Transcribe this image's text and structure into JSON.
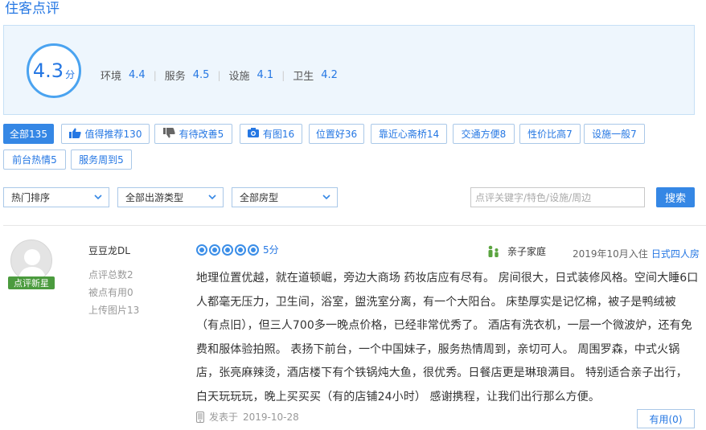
{
  "section_title": "住客点评",
  "overall": {
    "score": "4.3",
    "unit": "分"
  },
  "sub_scores": [
    {
      "label": "环境",
      "value": "4.4"
    },
    {
      "label": "服务",
      "value": "4.5"
    },
    {
      "label": "设施",
      "value": "4.1"
    },
    {
      "label": "卫生",
      "value": "4.2"
    }
  ],
  "tags": [
    {
      "label": "全部135",
      "active": true,
      "icon": ""
    },
    {
      "label": "值得推荐130",
      "active": false,
      "icon": "thumbs-up-icon"
    },
    {
      "label": "有待改善5",
      "active": false,
      "icon": "thumbs-down-icon"
    },
    {
      "label": "有图16",
      "active": false,
      "icon": "camera-icon"
    },
    {
      "label": "位置好36",
      "active": false,
      "icon": ""
    },
    {
      "label": "靠近心斋桥14",
      "active": false,
      "icon": ""
    },
    {
      "label": "交通方便8",
      "active": false,
      "icon": ""
    },
    {
      "label": "性价比高7",
      "active": false,
      "icon": ""
    },
    {
      "label": "设施一般7",
      "active": false,
      "icon": ""
    },
    {
      "label": "前台热情5",
      "active": false,
      "icon": ""
    },
    {
      "label": "服务周到5",
      "active": false,
      "icon": ""
    }
  ],
  "filters": {
    "sort": "热门排序",
    "trip_type": "全部出游类型",
    "room_type": "全部房型",
    "search_placeholder": "点评关键字/特色/设施/周边",
    "search_button": "搜索"
  },
  "review": {
    "user_name": "豆豆龙DL",
    "badge": "点评新星",
    "stats": [
      "点评总数2",
      "被点有用0",
      "上传图片13"
    ],
    "rating_label": "5分",
    "rating_value": 5,
    "trip_type": "亲子家庭",
    "stay_date": "2019年10月入住",
    "room": "日式四人房",
    "content_lines": [
      "地理位置优越，就在道顿崛，旁边大商场 药妆店应有尽有。 房间很大，日式装修风格。空间大睡6口",
      "人都毫无压力，卫生间，浴室，盥洗室分离，有一个大阳台。 床垫厚实是记忆棉，被子是鸭绒被",
      "（有点旧），但三人700多一晚点价格，已经非常优秀了。 酒店有洗衣机，一层一个微波炉，还有免",
      "费和服体验拍照。 表扬下前台，一个中国妹子，服务热情周到，亲切可人。 周围罗森，中式火锅",
      "店，张亮麻辣烫，酒店楼下有个铁锅炖大鱼，很优秀。日餐店更是琳琅满目。 特别适合亲子出行，",
      "白天玩玩玩，晚上买买买（有的店铺24小时） 感谢携程，让我们出行那么方便。"
    ],
    "posted_prefix": "发表于",
    "posted_date": "2019-10-28",
    "useful_label": "有用(0)"
  },
  "colors": {
    "accent": "#2577e3",
    "button": "#3587e5",
    "badge": "#4b9b3e",
    "panel": "#eef6fd"
  }
}
